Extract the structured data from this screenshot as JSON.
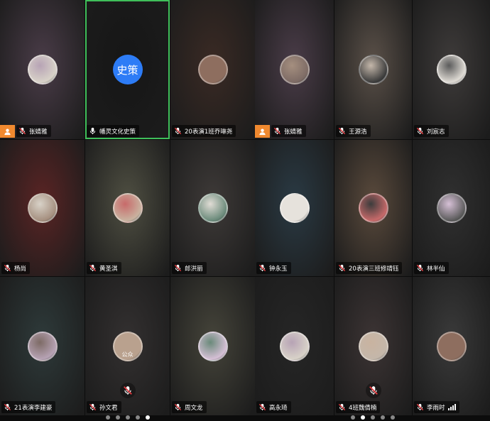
{
  "left_grid": {
    "tiles": [
      {
        "name": "张婧雅",
        "avatar_type": "photo",
        "host": true,
        "mic": "muted",
        "bg": "#4a3c48"
      },
      {
        "name": "幡灵文化史策",
        "avatar_type": "text",
        "avatar_text": "史策",
        "host": false,
        "mic": "on",
        "bg": "#161616",
        "active": true
      },
      {
        "name": "20表演1班乔琳尧",
        "avatar_type": "photo",
        "host": false,
        "mic": "muted",
        "bg": "#3a2a24"
      },
      {
        "name": "杨尚",
        "avatar_type": "photo",
        "host": false,
        "mic": "muted",
        "bg": "#5a2424"
      },
      {
        "name": "黄圣淇",
        "avatar_type": "photo",
        "host": false,
        "mic": "muted",
        "bg": "#4f4f42"
      },
      {
        "name": "郎洪丽",
        "avatar_type": "photo",
        "host": false,
        "mic": "muted",
        "bg": "#3e3a38"
      },
      {
        "name": "21表演李建豪",
        "avatar_type": "photo",
        "host": false,
        "mic": "muted",
        "bg": "#2e3a3a"
      },
      {
        "name": "孙文君",
        "avatar_type": "photo",
        "host": false,
        "mic": "muted",
        "bg": "#333030",
        "avatar_caption": "公众",
        "muted_overlay": true
      },
      {
        "name": "周文龙",
        "avatar_type": "photo",
        "host": false,
        "mic": "muted",
        "bg": "#45443a"
      }
    ],
    "page_dots": 5,
    "active_dot": 4
  },
  "right_grid": {
    "tiles": [
      {
        "name": "张婧雅",
        "avatar_type": "photo",
        "host": true,
        "mic": "muted",
        "bg": "#4a3c48"
      },
      {
        "name": "王源浩",
        "avatar_type": "photo",
        "host": false,
        "mic": "muted",
        "bg": "#5a5048"
      },
      {
        "name": "刘宸志",
        "avatar_type": "photo",
        "host": false,
        "mic": "muted",
        "bg": "#3e3b3a"
      },
      {
        "name": "钟永玉",
        "avatar_type": "photo",
        "host": false,
        "mic": "muted",
        "bg": "#2a3a44"
      },
      {
        "name": "20表演三班修靖钰",
        "avatar_type": "photo",
        "host": false,
        "mic": "muted",
        "bg": "#5a4a3c"
      },
      {
        "name": "林半仙",
        "avatar_type": "photo",
        "host": false,
        "mic": "muted",
        "bg": "#303030"
      },
      {
        "name": "高永琦",
        "avatar_type": "photo",
        "host": false,
        "mic": "muted",
        "bg": "#262626"
      },
      {
        "name": "4班魏倩楠",
        "avatar_type": "photo",
        "host": false,
        "mic": "muted",
        "bg": "#3c3434",
        "muted_overlay": true
      },
      {
        "name": "李雨时",
        "avatar_type": "photo",
        "host": false,
        "mic": "muted",
        "bg": "#3a3a3a",
        "signal": true
      }
    ],
    "page_dots": 5,
    "active_dot": 1
  },
  "colors": {
    "active_border": "#3fbf5a",
    "host_badge": "#f0892f",
    "text_avatar": "#2d7cf6",
    "mute_red": "#e0393e"
  },
  "icons": {
    "mic_muted": "mic-muted-icon",
    "mic_on": "mic-icon",
    "host": "person-icon",
    "signal": "signal-icon"
  }
}
